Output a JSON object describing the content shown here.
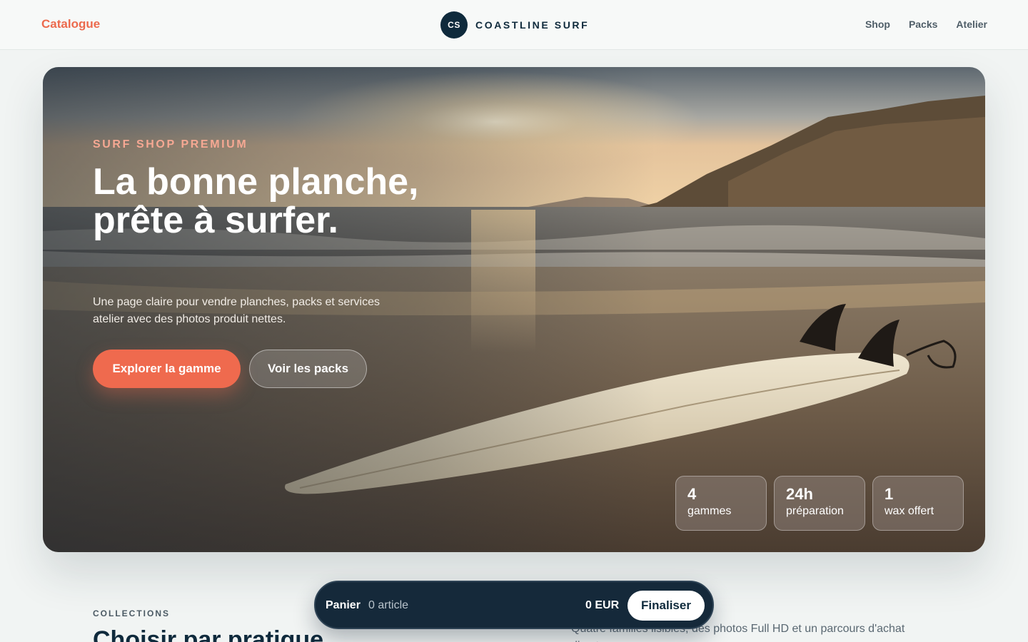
{
  "header": {
    "catalogue_link": "Catalogue",
    "brand_initials": "CS",
    "brand_name": "COASTLINE SURF",
    "nav": [
      "Shop",
      "Packs",
      "Atelier"
    ]
  },
  "hero": {
    "eyebrow": "SURF SHOP PREMIUM",
    "headline": "La bonne planche, prête à surfer.",
    "subtitle": "Une page claire pour vendre planches, packs et services atelier avec des photos produit nettes.",
    "primary_cta": "Explorer la gamme",
    "secondary_cta": "Voir les packs",
    "stats": [
      {
        "value": "4",
        "label": "gammes"
      },
      {
        "value": "24h",
        "label": "préparation"
      },
      {
        "value": "1",
        "label": "wax offert"
      }
    ]
  },
  "collections": {
    "eyebrow": "COLLECTIONS",
    "title": "Choisir par pratique",
    "description": "Quatre familles lisibles, des photos Full HD et un parcours d'achat direct."
  },
  "cart": {
    "label": "Panier",
    "count": "0 article",
    "total": "0 EUR",
    "checkout": "Finaliser"
  },
  "colors": {
    "accent": "#ef6a4e",
    "navy": "#0f2a3c",
    "cart_bg": "#15293a"
  }
}
